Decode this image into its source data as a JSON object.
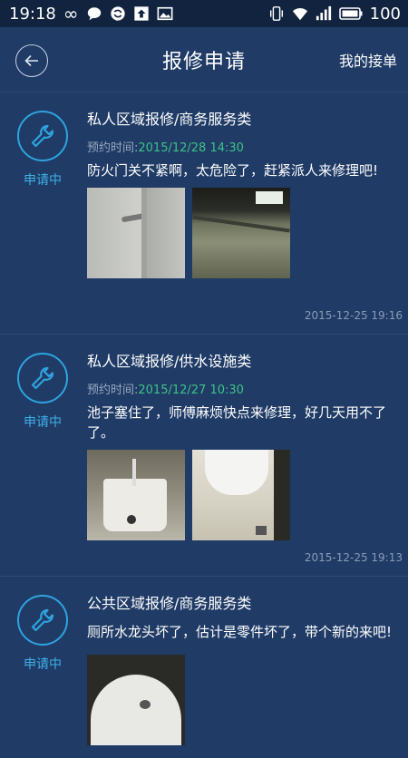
{
  "status_bar": {
    "time": "19:18",
    "battery": "100"
  },
  "header": {
    "title": "报修申请",
    "right_link": "我的接单"
  },
  "cards": [
    {
      "category": "私人区域报修/商务服务类",
      "appointment_label": "预约时间:",
      "appointment_time": "2015/12/28 14:30",
      "description": "防火门关不紧啊，太危险了，赶紧派人来修理吧!",
      "status": "申请中",
      "timestamp": "2015-12-25 19:16"
    },
    {
      "category": "私人区域报修/供水设施类",
      "appointment_label": "预约时间:",
      "appointment_time": "2015/12/27 10:30",
      "description": "池子塞住了，师傅麻烦快点来修理，好几天用不了了。",
      "status": "申请中",
      "timestamp": "2015-12-25 19:13"
    },
    {
      "category": "公共区域报修/商务服务类",
      "description": "厕所水龙头坏了，估计是零件坏了，带个新的来吧!",
      "status": "申请中"
    }
  ]
}
